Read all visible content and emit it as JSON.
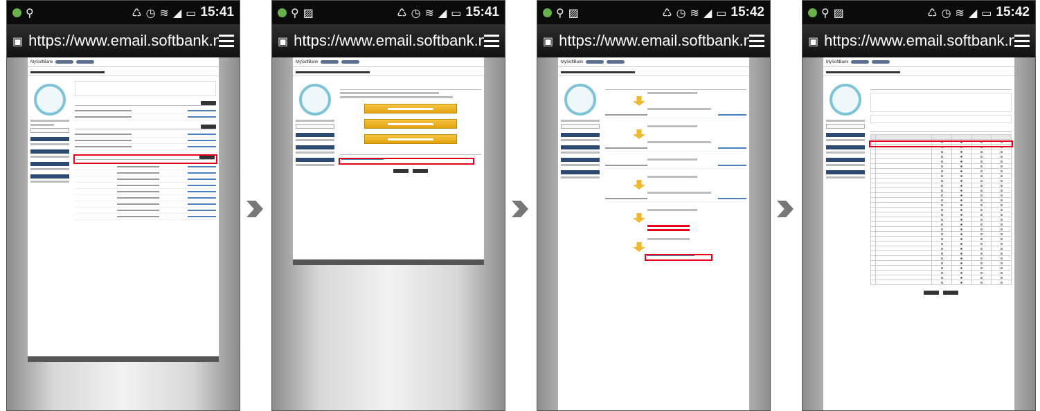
{
  "phones": [
    {
      "time": "15:41",
      "url": "https://www.email.softbank.ne"
    },
    {
      "time": "15:41",
      "url": "https://www.email.softbank.ne"
    },
    {
      "time": "15:42",
      "url": "https://www.email.softbank.ne"
    },
    {
      "time": "15:42",
      "url": "https://www.email.softbank.ne"
    }
  ],
  "page": {
    "brand": "MySoftBank"
  },
  "icons": {
    "status_left": [
      "android-icon",
      "usb-icon",
      "image-icon"
    ],
    "status_right": [
      "sync-icon",
      "alarm-icon",
      "wifi-icon",
      "signal-icon",
      "battery-icon"
    ],
    "url": "lock-page-icon",
    "menu": "menu-icon",
    "step": "chevron-right-icon"
  },
  "colors": {
    "highlight": "#e2001a",
    "brand_nav": "#2e4a72",
    "accent_yellow": "#f1b82d",
    "logo_ring": "#7fc4d6"
  }
}
